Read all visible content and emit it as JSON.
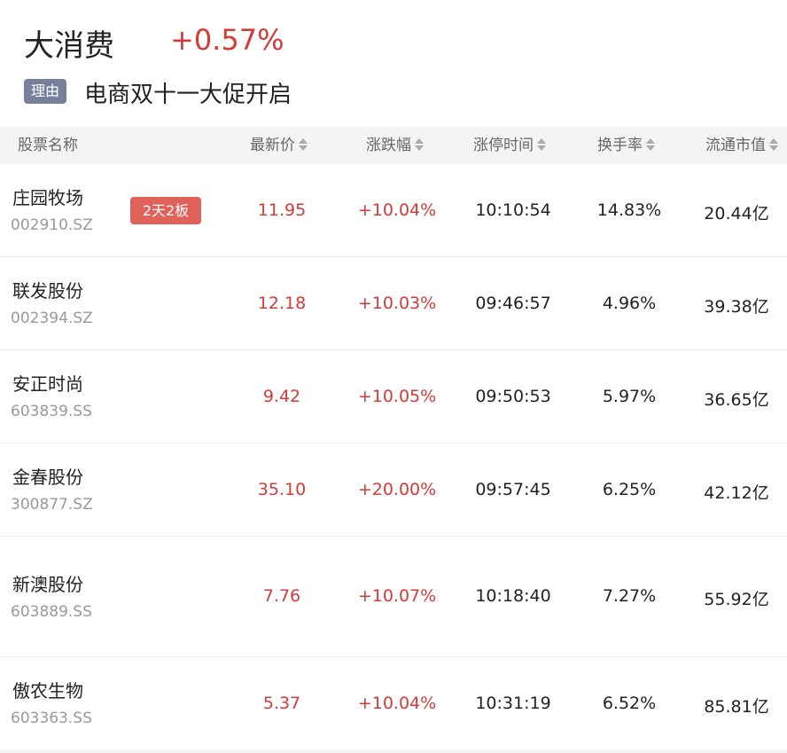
{
  "sector": {
    "name": "大消费",
    "change": "+0.57%",
    "reason_tag": "理由",
    "reason_text": "电商双十一大促开启"
  },
  "columns": [
    "股票名称",
    "最新价",
    "涨跌幅",
    "涨停时间",
    "换手率",
    "流通市值"
  ],
  "rows": [
    {
      "name": "庄园牧场",
      "code": "002910.SZ",
      "badge": "2天2板",
      "price": "11.95",
      "change": "+10.04%",
      "limit_time": "10:10:54",
      "turnover": "14.83%",
      "float_cap": "20.44亿"
    },
    {
      "name": "联发股份",
      "code": "002394.SZ",
      "price": "12.18",
      "change": "+10.03%",
      "limit_time": "09:46:57",
      "turnover": "4.96%",
      "float_cap": "39.38亿"
    },
    {
      "name": "安正时尚",
      "code": "603839.SS",
      "price": "9.42",
      "change": "+10.05%",
      "limit_time": "09:50:53",
      "turnover": "5.97%",
      "float_cap": "36.65亿"
    },
    {
      "name": "金春股份",
      "code": "300877.SZ",
      "price": "35.10",
      "change": "+20.00%",
      "limit_time": "09:57:45",
      "turnover": "6.25%",
      "float_cap": "42.12亿"
    },
    {
      "name": "新澳股份",
      "code": "603889.SS",
      "price": "7.76",
      "change": "+10.07%",
      "limit_time": "10:18:40",
      "turnover": "7.27%",
      "float_cap": "55.92亿"
    },
    {
      "name": "傲农生物",
      "code": "603363.SS",
      "price": "5.37",
      "change": "+10.04%",
      "limit_time": "10:31:19",
      "turnover": "6.52%",
      "float_cap": "85.81亿"
    }
  ],
  "colors": {
    "up": "#d23b38",
    "badge": "#e0605a",
    "tag": "#76809b"
  }
}
